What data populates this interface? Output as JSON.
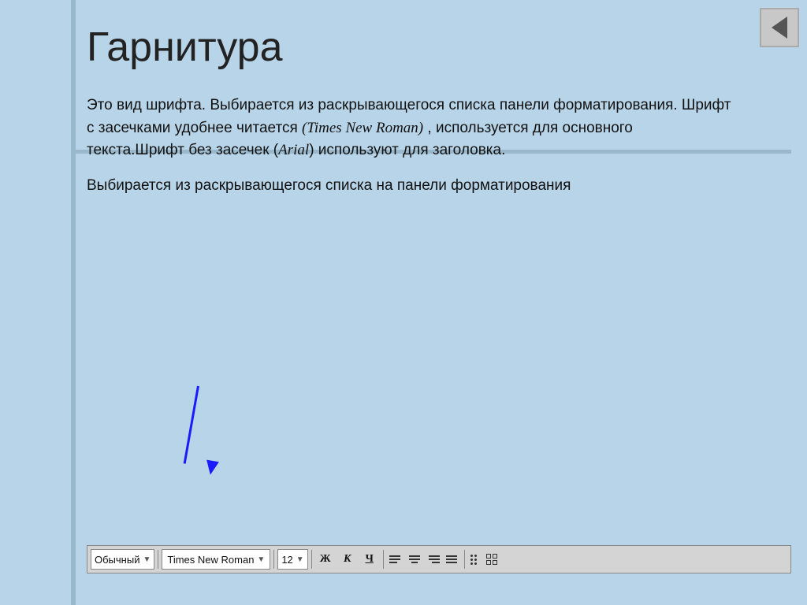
{
  "slide": {
    "title": "Гарнитура",
    "body_paragraph_1": "Это вид шрифта. Выбирается из раскрывающегося списка панели форматирования.  Шрифт с засечками удобнее читается ",
    "italic_part": "(Times New   Roman)",
    "body_paragraph_1b": " , используется для основного текста.Шрифт без засечек (",
    "italic_arial": "Arial",
    "body_paragraph_1c": ") используют для заголовка.",
    "body_paragraph_2": "Выбирается из раскрывающегося списка на панели форматирования",
    "toolbar": {
      "style_label": "Обычный",
      "style_arrow": "▼",
      "font_label": "Times New Roman",
      "font_arrow": "▼",
      "size_label": "12",
      "size_arrow": "▼",
      "bold_label": "Ж",
      "italic_label": "К",
      "underline_label": "Ч"
    }
  }
}
